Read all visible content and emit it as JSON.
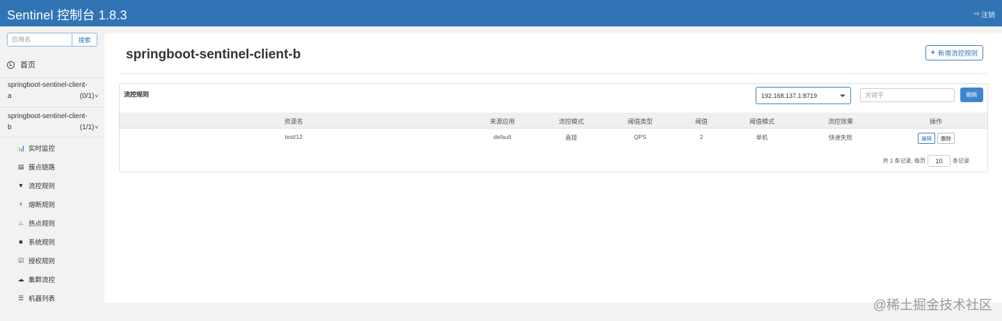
{
  "header": {
    "title": "Sentinel 控制台 1.8.3",
    "logout_label": "注销"
  },
  "sidebar": {
    "search_placeholder": "应用名",
    "search_button": "搜索",
    "home_label": "首页",
    "apps": [
      {
        "name_line1": "springboot-sentinel-client-",
        "name_line2": "a",
        "count": "(0/1)"
      },
      {
        "name_line1": "springboot-sentinel-client-",
        "name_line2": "b",
        "count": "(1/1)"
      }
    ],
    "menu": [
      {
        "icon": "bar-chart-icon",
        "label": "实时监控"
      },
      {
        "icon": "list-icon",
        "label": "簇点链路"
      },
      {
        "icon": "filter-icon",
        "label": "流控规则"
      },
      {
        "icon": "flash-icon",
        "label": "熔断规则"
      },
      {
        "icon": "fire-icon",
        "label": "热点规则"
      },
      {
        "icon": "lock-icon",
        "label": "系统规则"
      },
      {
        "icon": "check-square-icon",
        "label": "授权规则"
      },
      {
        "icon": "cloud-icon",
        "label": "集群流控"
      },
      {
        "icon": "th-list-icon",
        "label": "机器列表"
      }
    ]
  },
  "main": {
    "title": "springboot-sentinel-client-b",
    "add_button": "新增流控规则",
    "panel": {
      "title": "流控规则",
      "machine": "192.168.137.1:8719",
      "keyword_placeholder": "关键字",
      "refresh_button": "刷新",
      "columns": [
        "资源名",
        "来源应用",
        "流控模式",
        "阈值类型",
        "阈值",
        "阈值模式",
        "流控效果",
        "操作"
      ],
      "rows": [
        {
          "resource": "test/12",
          "limit_app": "default",
          "strategy": "直接",
          "grade": "QPS",
          "count": "2",
          "cluster_mode": "单机",
          "behavior": "快速失败",
          "edit": "编辑",
          "delete": "删除"
        }
      ],
      "pager": {
        "prefix": "共 1 条记录, 每页",
        "page_size": "10",
        "suffix": "条记录"
      }
    }
  },
  "watermark": "@稀土掘金技术社区",
  "colors": {
    "header_bg": "#3074b5",
    "accent": "#3c7dc0",
    "refresh_bg": "#3d86cf"
  }
}
